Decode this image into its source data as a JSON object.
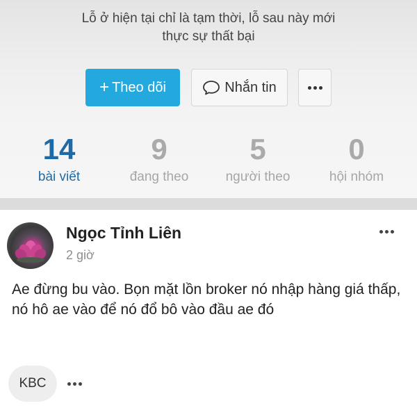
{
  "profile": {
    "bio_line1": "Lỗ ở hiện tại chỉ là tạm thời, lỗ sau này mới",
    "bio_line2": "thực sự thất bại"
  },
  "actions": {
    "follow_label": "Theo dõi",
    "message_label": "Nhắn tin"
  },
  "stats": [
    {
      "value": "14",
      "label": "bài viết",
      "active": true
    },
    {
      "value": "9",
      "label": "đang theo",
      "active": false
    },
    {
      "value": "5",
      "label": "người theo",
      "active": false
    },
    {
      "value": "0",
      "label": "hội nhóm",
      "active": false
    }
  ],
  "post": {
    "author": "Ngọc Tỉnh Liên",
    "time": "2 giờ",
    "content": "Ae đừng bu vào. Bọn mặt lồn broker nó nhập hàng giá thấp, nó hô ae vào để nó đổ bô vào đầu ae đó",
    "tag": "KBC"
  },
  "colors": {
    "accent": "#23a9de",
    "active_stat": "#1e6aa6"
  }
}
